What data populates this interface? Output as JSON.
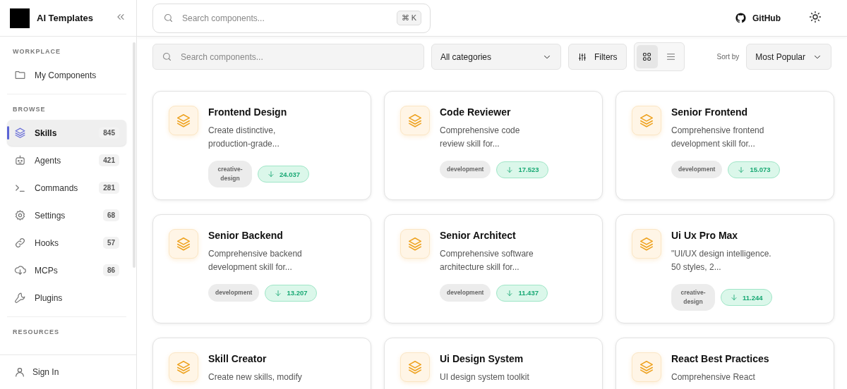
{
  "sidebar": {
    "brand": "AI Templates",
    "sections": [
      {
        "heading": "WORKPLACE",
        "items": [
          {
            "label": "My Components",
            "selected": false
          }
        ]
      },
      {
        "heading": "BROWSE",
        "items": [
          {
            "label": "Skills",
            "count": "845",
            "selected": true
          },
          {
            "label": "Agents",
            "count": "421",
            "selected": false
          },
          {
            "label": "Commands",
            "count": "281",
            "selected": false
          },
          {
            "label": "Settings",
            "count": "68",
            "selected": false
          },
          {
            "label": "Hooks",
            "count": "57",
            "selected": false
          },
          {
            "label": "MCPs",
            "count": "86",
            "selected": false
          },
          {
            "label": "Plugins",
            "selected": false
          }
        ]
      },
      {
        "heading": "RESOURCES"
      }
    ],
    "footer": {
      "label": "Sign In"
    }
  },
  "header": {
    "search": {
      "placeholder": "Search components..."
    },
    "shortcut": "⌘ K",
    "github": "GitHub"
  },
  "toolbar": {
    "search": {
      "placeholder": "Search components..."
    },
    "category": "All categories",
    "filters": "Filters",
    "views": [
      {
        "kind": "grid",
        "selected": true
      },
      {
        "kind": "list",
        "selected": false
      }
    ],
    "sort_label": "Sort by",
    "sort": "Most Popular"
  },
  "cards": [
    {
      "title": "Frontend Design",
      "description": "Create distinctive, production-grade...",
      "tag": "creative-design",
      "downloads": "24.037"
    },
    {
      "title": "Code Reviewer",
      "description": "Comprehensive code review skill for...",
      "tag": "development",
      "downloads": "17.523"
    },
    {
      "title": "Senior Frontend",
      "description": "Comprehensive frontend development skill for...",
      "tag": "development",
      "downloads": "15.073"
    },
    {
      "title": "Senior Backend",
      "description": "Comprehensive backend development skill for...",
      "tag": "development",
      "downloads": "13.207"
    },
    {
      "title": "Senior Architect",
      "description": "Comprehensive software architecture skill for...",
      "tag": "development",
      "downloads": "11.437"
    },
    {
      "title": "Ui Ux Pro Max",
      "description": "\"UI/UX design intelligence. 50 styles, 2...",
      "tag": "creative-design",
      "downloads": "11.244"
    },
    {
      "title": "Skill Creator",
      "description": "Create new skills, modify"
    },
    {
      "title": "Ui Design System",
      "description": "UI design system toolkit"
    },
    {
      "title": "React Best Practices",
      "description": "Comprehensive React"
    }
  ]
}
